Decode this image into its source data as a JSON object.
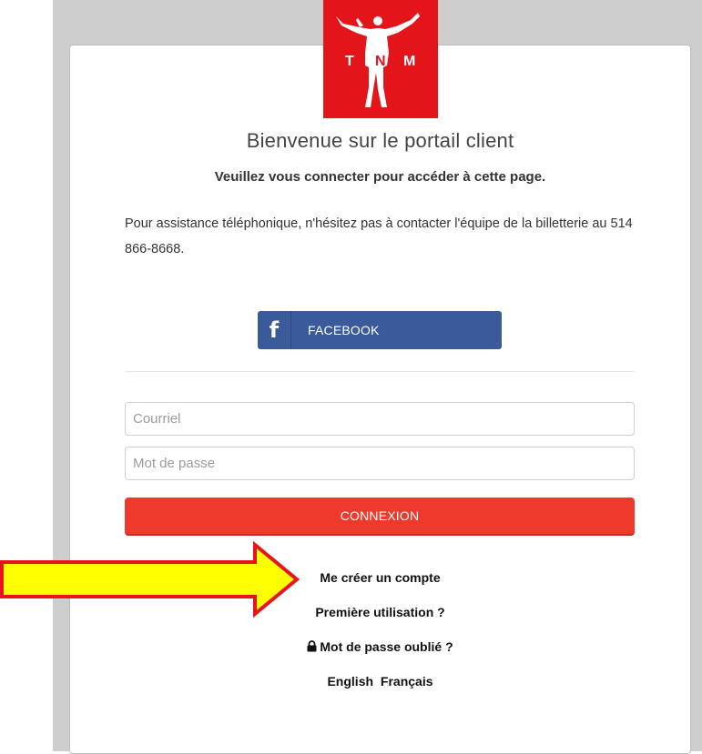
{
  "brand": {
    "logo_letters": [
      "T",
      "N",
      "M"
    ],
    "logo_color": "#e3151b"
  },
  "header": {
    "welcome": "Bienvenue sur le portail client",
    "subtitle": "Veuillez vous connecter pour accéder à cette page."
  },
  "assistance": {
    "text": "Pour assistance téléphonique, n'hésitez pas à contacter l'équipe de la billetterie au 514 866-8668."
  },
  "social": {
    "facebook_label": "FACEBOOK",
    "facebook_icon": "facebook-f-icon",
    "facebook_color": "#3b5a9a"
  },
  "form": {
    "email_placeholder": "Courriel",
    "password_placeholder": "Mot de passe",
    "login_label": "CONNEXION",
    "login_color": "#ee3a2d"
  },
  "links": {
    "create_account": "Me créer un compte",
    "first_use": "Première utilisation ?",
    "forgot_password": "Mot de passe oublié ?",
    "forgot_icon": "lock-icon"
  },
  "languages": {
    "english": "English",
    "french": "Français"
  },
  "annotation": {
    "arrow_fill": "#ffff00",
    "arrow_stroke": "#e8141c"
  }
}
